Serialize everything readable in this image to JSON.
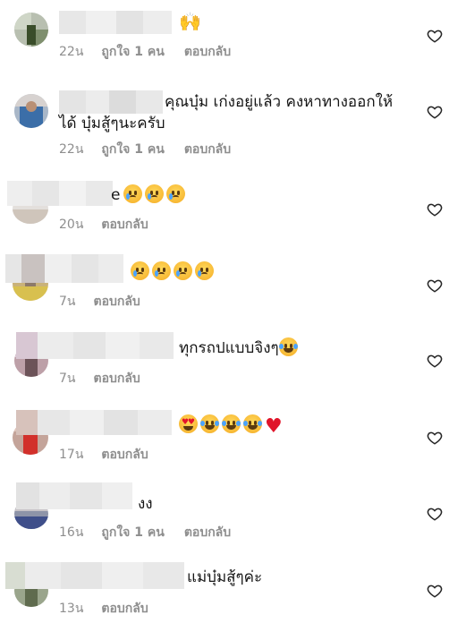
{
  "comments": [
    {
      "text": "",
      "time": "22น",
      "likes": "ถูกใจ 1 คน",
      "reply": "ตอบกลับ",
      "emoji_after": "raising-hands"
    },
    {
      "text": "คุณบุ๋ม เก่งอยู่แล้ว คงหาทางออกให้",
      "text2": "ได้ บุ๋มสู้ๆนะครับ",
      "time": "22น",
      "likes": "ถูกใจ 1 คน",
      "reply": "ตอบกลับ"
    },
    {
      "text": "e",
      "time": "20น",
      "likes": "",
      "reply": "ตอบกลับ",
      "emojis": [
        "crying",
        "crying",
        "crying"
      ]
    },
    {
      "text": "",
      "time": "7น",
      "likes": "",
      "reply": "ตอบกลับ",
      "emojis": [
        "crying",
        "crying",
        "crying",
        "crying"
      ]
    },
    {
      "text": "ทุกรถปแบบจิงๆ",
      "time": "7น",
      "likes": "",
      "reply": "ตอบกลับ",
      "emojis": [
        "laughing"
      ]
    },
    {
      "text": "",
      "time": "17น",
      "likes": "",
      "reply": "ตอบกลับ",
      "emojis": [
        "heart-eyes",
        "laughing",
        "laughing",
        "laughing",
        "red-heart"
      ]
    },
    {
      "text": "งง",
      "time": "16น",
      "likes": "ถูกใจ 1 คน",
      "reply": "ตอบกลับ"
    },
    {
      "text": "แม่บุ๋มสู้ๆค่ะ",
      "time": "13น",
      "likes": "",
      "reply": "ตอบกลับ"
    }
  ],
  "icons": {
    "like": "heart-outline-icon"
  },
  "colors": {
    "meta": "#8e8e8e",
    "heart_red": "#e0152a",
    "text": "#151515"
  }
}
